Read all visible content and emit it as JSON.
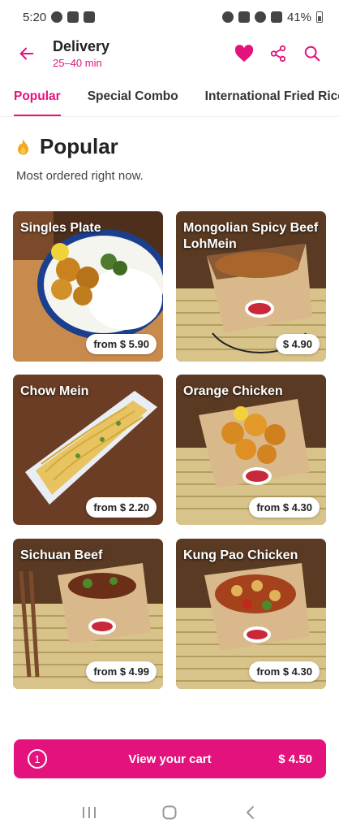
{
  "status_bar": {
    "time": "5:20",
    "battery": "41%"
  },
  "header": {
    "title": "Delivery",
    "subtitle": "25–40 min"
  },
  "tabs": [
    {
      "label": "Popular",
      "active": true
    },
    {
      "label": "Special Combo",
      "active": false
    },
    {
      "label": "International Fried Rice",
      "active": false
    }
  ],
  "section": {
    "icon": "flame-icon",
    "title": "Popular",
    "subtitle": "Most ordered right now."
  },
  "items": [
    {
      "name": "Singles Plate",
      "price": "from $ 5.90"
    },
    {
      "name": "Mongolian Spicy Beef LohMein",
      "price": "$ 4.90"
    },
    {
      "name": "Chow Mein",
      "price": "from $ 2.20"
    },
    {
      "name": "Orange Chicken",
      "price": "from $ 4.30"
    },
    {
      "name": "Sichuan Beef",
      "price": "from $ 4.99"
    },
    {
      "name": "Kung Pao Chicken",
      "price": "from $ 4.30"
    }
  ],
  "cart": {
    "count": "1",
    "label": "View your cart",
    "total": "$ 4.50"
  },
  "colors": {
    "accent": "#e3127c"
  }
}
